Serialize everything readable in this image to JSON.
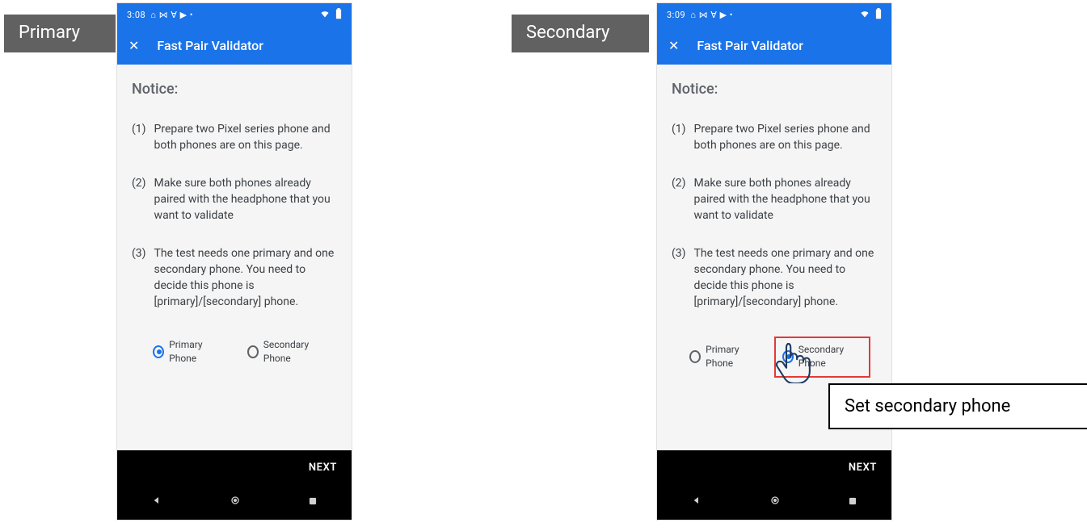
{
  "tags": {
    "primary": "Primary",
    "secondary": "Secondary"
  },
  "caption": "Set secondary phone",
  "phone_left": {
    "time": "3:08",
    "app_title": "Fast Pair Validator",
    "notice_heading": "Notice:",
    "steps": [
      {
        "num": "(1)",
        "text": "Prepare two Pixel series phone and both phones are on this page."
      },
      {
        "num": "(2)",
        "text": "Make sure both phones already paired with the headphone that you want to validate"
      },
      {
        "num": "(3)",
        "text": "The test needs one primary and one secondary phone. You need to decide this phone is [primary]/[secondary] phone."
      }
    ],
    "radio_primary": "Primary Phone",
    "radio_secondary": "Secondary Phone",
    "selected": "primary",
    "next": "NEXT"
  },
  "phone_right": {
    "time": "3:09",
    "app_title": "Fast Pair Validator",
    "notice_heading": "Notice:",
    "steps": [
      {
        "num": "(1)",
        "text": "Prepare two Pixel series phone and both phones are on this page."
      },
      {
        "num": "(2)",
        "text": "Make sure both phones already paired with the headphone that you want to validate"
      },
      {
        "num": "(3)",
        "text": "The test needs one primary and one secondary phone. You need to decide this phone is [primary]/[secondary] phone."
      }
    ],
    "radio_primary": "Primary Phone",
    "radio_secondary": "Secondary Phone",
    "selected": "secondary",
    "next": "NEXT"
  }
}
